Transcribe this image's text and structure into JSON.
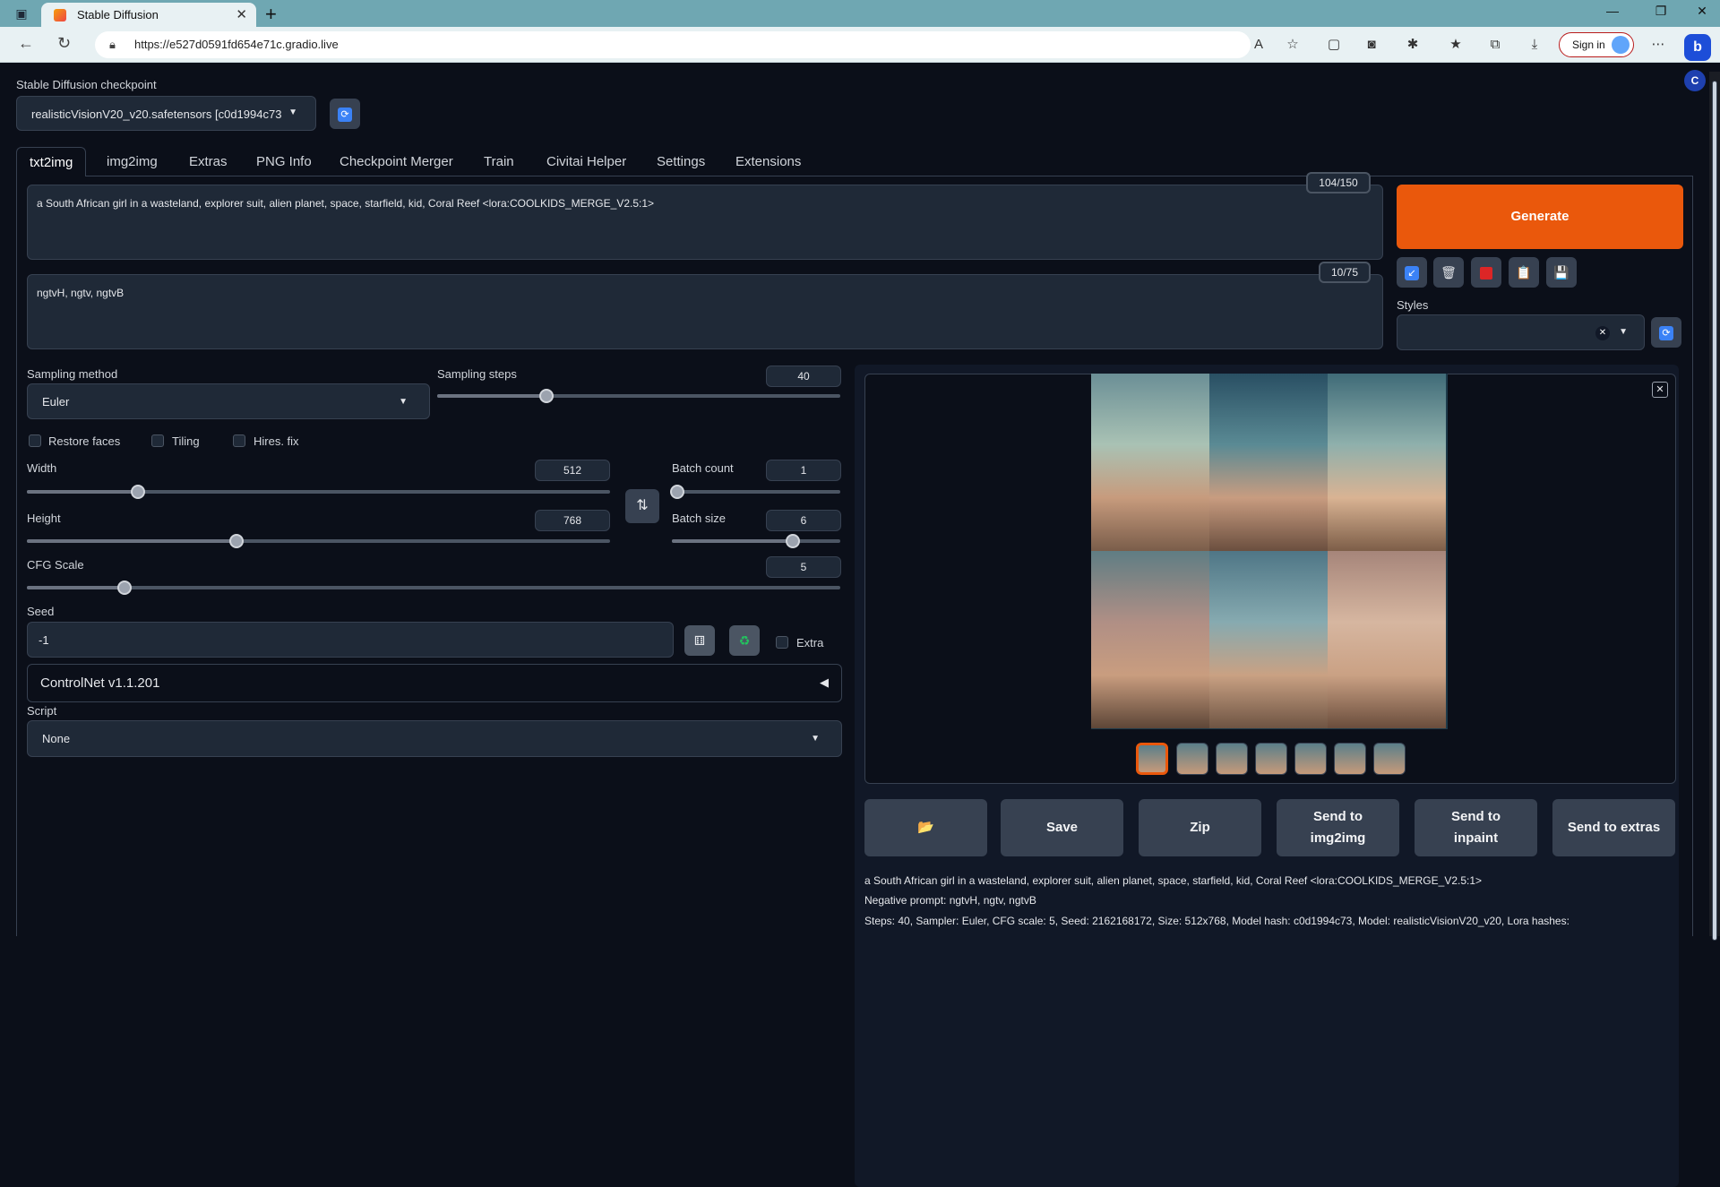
{
  "browser": {
    "tab_title": "Stable Diffusion",
    "url": "https://e527d0591fd654e71c.gradio.live",
    "sign_in": "Sign in"
  },
  "checkpoint": {
    "label": "Stable Diffusion checkpoint",
    "value": "realisticVisionV20_v20.safetensors [c0d1994c73"
  },
  "tabs": [
    "txt2img",
    "img2img",
    "Extras",
    "PNG Info",
    "Checkpoint Merger",
    "Train",
    "Civitai Helper",
    "Settings",
    "Extensions"
  ],
  "prompt": {
    "positive": "a South African girl in a wasteland, explorer suit, alien planet, space, starfield, kid, Coral Reef <lora:COOLKIDS_MERGE_V2.5:1>",
    "positive_count": "104/150",
    "negative": "ngtvH, ngtv, ngtvB",
    "negative_count": "10/75"
  },
  "generate_label": "Generate",
  "styles_label": "Styles",
  "sampling": {
    "method_label": "Sampling method",
    "method_value": "Euler",
    "steps_label": "Sampling steps",
    "steps_value": "40"
  },
  "checkboxes": {
    "restore_faces": "Restore faces",
    "tiling": "Tiling",
    "hires_fix": "Hires. fix",
    "extra": "Extra"
  },
  "dims": {
    "width_label": "Width",
    "width_value": "512",
    "height_label": "Height",
    "height_value": "768",
    "batch_count_label": "Batch count",
    "batch_count_value": "1",
    "batch_size_label": "Batch size",
    "batch_size_value": "6",
    "cfg_label": "CFG Scale",
    "cfg_value": "5"
  },
  "seed": {
    "label": "Seed",
    "value": "-1"
  },
  "controlnet_label": "ControlNet v1.1.201",
  "script": {
    "label": "Script",
    "value": "None"
  },
  "actions": {
    "folder": "📂",
    "save": "Save",
    "zip": "Zip",
    "img2img_l1": "Send to",
    "img2img_l2": "img2img",
    "inpaint_l1": "Send to",
    "inpaint_l2": "inpaint",
    "extras": "Send to extras"
  },
  "info": {
    "prompt": "a South African girl in a wasteland, explorer suit, alien planet, space, starfield, kid, Coral Reef <lora:COOLKIDS_MERGE_V2.5:1>",
    "negative": "Negative prompt: ngtvH, ngtv, ngtvB",
    "params": "Steps: 40, Sampler: Euler, CFG scale: 5, Seed: 2162168172, Size: 512x768, Model hash: c0d1994c73, Model: realisticVisionV20_v20, Lora hashes:"
  },
  "colors": {
    "accent": "#ea580c",
    "background": "#0b0f19",
    "panel": "#1f2937"
  }
}
